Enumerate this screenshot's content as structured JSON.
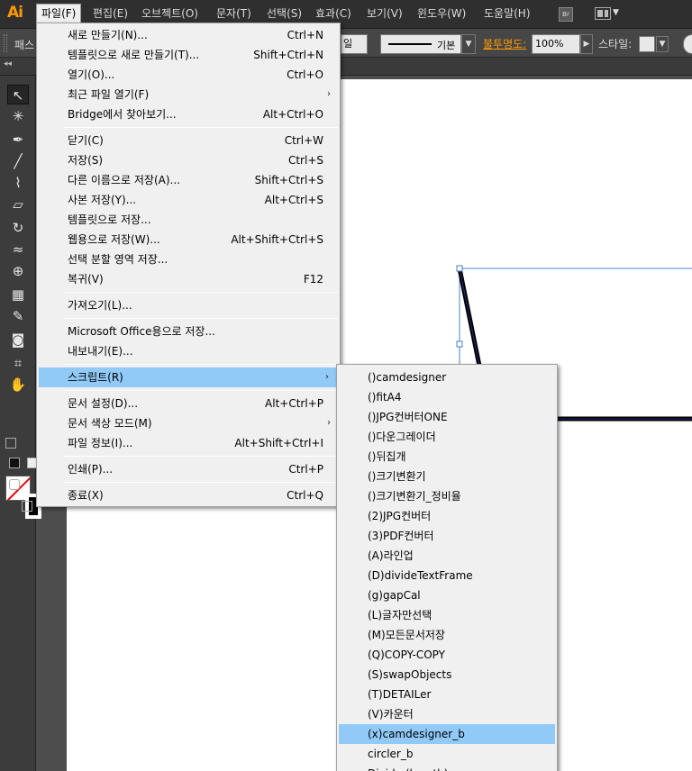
{
  "app": {
    "logo": "Ai",
    "bridge_label": "Br"
  },
  "menubar": {
    "items": [
      {
        "label": "파일(F)"
      },
      {
        "label": "편집(E)"
      },
      {
        "label": "오브젝트(O)"
      },
      {
        "label": "문자(T)"
      },
      {
        "label": "선택(S)"
      },
      {
        "label": "효과(C)"
      },
      {
        "label": "보기(V)"
      },
      {
        "label": "윈도우(W)"
      },
      {
        "label": "도움말(H)"
      }
    ]
  },
  "controlbar": {
    "panel_label": "패스",
    "stroke_fragment": "일",
    "stroke_style_label": "기본",
    "opacity_label": "불투명도:",
    "opacity_value": "100%",
    "style_label": "스타일:"
  },
  "file_menu": {
    "items": [
      {
        "label": "새로 만들기(N)...",
        "shortcut": "Ctrl+N"
      },
      {
        "label": "템플릿으로 새로 만들기(T)...",
        "shortcut": "Shift+Ctrl+N"
      },
      {
        "label": "열기(O)...",
        "shortcut": "Ctrl+O"
      },
      {
        "label": "최근 파일 열기(F)",
        "shortcut": ""
      },
      {
        "label": "Bridge에서 찾아보기...",
        "shortcut": "Alt+Ctrl+O"
      },
      {
        "label": "닫기(C)",
        "shortcut": "Ctrl+W"
      },
      {
        "label": "저장(S)",
        "shortcut": "Ctrl+S"
      },
      {
        "label": "다른 이름으로 저장(A)...",
        "shortcut": "Shift+Ctrl+S"
      },
      {
        "label": "사본 저장(Y)...",
        "shortcut": "Alt+Ctrl+S"
      },
      {
        "label": "템플릿으로 저장...",
        "shortcut": ""
      },
      {
        "label": "웹용으로 저장(W)...",
        "shortcut": "Alt+Shift+Ctrl+S"
      },
      {
        "label": "선택 분할 영역 저장...",
        "shortcut": ""
      },
      {
        "label": "복귀(V)",
        "shortcut": "F12"
      },
      {
        "label": "가져오기(L)...",
        "shortcut": ""
      },
      {
        "label": "Microsoft Office용으로 저장...",
        "shortcut": ""
      },
      {
        "label": "내보내기(E)...",
        "shortcut": ""
      },
      {
        "label": "스크립트(R)",
        "shortcut": ""
      },
      {
        "label": "문서 설정(D)...",
        "shortcut": "Alt+Ctrl+P"
      },
      {
        "label": "문서 색상 모드(M)",
        "shortcut": ""
      },
      {
        "label": "파일 정보(I)...",
        "shortcut": "Alt+Shift+Ctrl+I"
      },
      {
        "label": "인쇄(P)...",
        "shortcut": "Ctrl+P"
      },
      {
        "label": "종료(X)",
        "shortcut": "Ctrl+Q"
      }
    ]
  },
  "script_menu": {
    "items": [
      {
        "label": "()camdesigner"
      },
      {
        "label": "()fitA4"
      },
      {
        "label": "()JPG컨버터ONE"
      },
      {
        "label": "()다운그레이더"
      },
      {
        "label": "()뒤집개"
      },
      {
        "label": "()크기변환기"
      },
      {
        "label": "()크기변환기_정비율"
      },
      {
        "label": "(2)JPG컨버터"
      },
      {
        "label": "(3)PDF컨버터"
      },
      {
        "label": "(A)라인업"
      },
      {
        "label": "(D)divideTextFrame"
      },
      {
        "label": "(g)gapCal"
      },
      {
        "label": "(L)글자만선택"
      },
      {
        "label": "(M)모든문서저장"
      },
      {
        "label": "(Q)COPY-COPY"
      },
      {
        "label": "(S)swapObjects"
      },
      {
        "label": "(T)DETAILer"
      },
      {
        "label": "(V)카운터"
      },
      {
        "label": "(x)camdesigner_b"
      },
      {
        "label": "circler_b"
      },
      {
        "label": "Divide (length)"
      }
    ]
  },
  "colors": {
    "menu_highlight": "#91c9f7",
    "logo": "#ff9a00"
  }
}
